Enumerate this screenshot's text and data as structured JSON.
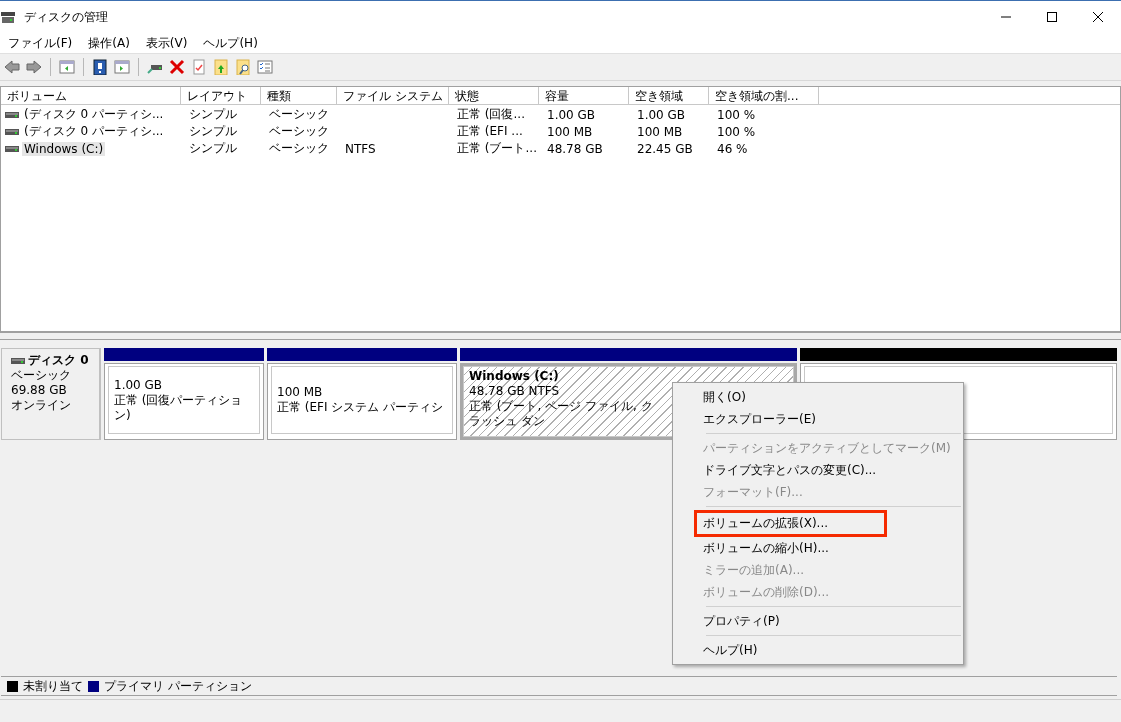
{
  "window": {
    "title": "ディスクの管理"
  },
  "menu_bar": [
    "ファイル(F)",
    "操作(A)",
    "表示(V)",
    "ヘルプ(H)"
  ],
  "volume_list": {
    "columns": [
      "ボリューム",
      "レイアウト",
      "種類",
      "ファイル システム",
      "状態",
      "容量",
      "空き領域",
      "空き領域の割..."
    ],
    "rows": [
      {
        "selected": false,
        "cells": [
          "(ディスク 0 パーティシ...",
          "シンプル",
          "ベーシック",
          "",
          "正常 (回復...",
          "1.00 GB",
          "1.00 GB",
          "100 %"
        ]
      },
      {
        "selected": false,
        "cells": [
          "(ディスク 0 パーティシ...",
          "シンプル",
          "ベーシック",
          "",
          "正常 (EFI ...",
          "100 MB",
          "100 MB",
          "100 %"
        ]
      },
      {
        "selected": true,
        "cells": [
          "Windows (C:)",
          "シンプル",
          "ベーシック",
          "NTFS",
          "正常 (ブート...",
          "48.78 GB",
          "22.45 GB",
          "46 %"
        ]
      }
    ]
  },
  "disks": [
    {
      "name": "ディスク 0",
      "type": "ベーシック",
      "size": "69.88 GB",
      "status": "オンライン",
      "partitions": [
        {
          "color": "#000080",
          "selected": false,
          "size": "1.00 GB",
          "status": "正常 (回復パーティション)"
        },
        {
          "color": "#000080",
          "selected": false,
          "size": "100 MB",
          "status": "正常 (EFI システム パーティシ"
        },
        {
          "color": "#000080",
          "selected": true,
          "title": "Windows (C:)",
          "size": "48.78 GB NTFS",
          "status": "正常 (ブート, ページ ファイル, クラッシュ ダン"
        },
        {
          "color": "#000000",
          "selected": false
        }
      ]
    }
  ],
  "context_menu": [
    {
      "kind": "item",
      "label": "開く(O)",
      "disabled": false,
      "highlighted": false
    },
    {
      "kind": "item",
      "label": "エクスプローラー(E)",
      "disabled": false,
      "highlighted": false
    },
    {
      "kind": "separator"
    },
    {
      "kind": "item",
      "label": "パーティションをアクティブとしてマーク(M)",
      "disabled": true,
      "highlighted": false
    },
    {
      "kind": "item",
      "label": "ドライブ文字とパスの変更(C)...",
      "disabled": false,
      "highlighted": false
    },
    {
      "kind": "item",
      "label": "フォーマット(F)...",
      "disabled": true,
      "highlighted": false
    },
    {
      "kind": "separator"
    },
    {
      "kind": "item",
      "label": "ボリュームの拡張(X)...",
      "disabled": false,
      "highlighted": true
    },
    {
      "kind": "item",
      "label": "ボリュームの縮小(H)...",
      "disabled": false,
      "highlighted": false
    },
    {
      "kind": "item",
      "label": "ミラーの追加(A)...",
      "disabled": true,
      "highlighted": false
    },
    {
      "kind": "item",
      "label": "ボリュームの削除(D)...",
      "disabled": true,
      "highlighted": false
    },
    {
      "kind": "separator"
    },
    {
      "kind": "item",
      "label": "プロパティ(P)",
      "disabled": false,
      "highlighted": false
    },
    {
      "kind": "separator"
    },
    {
      "kind": "item",
      "label": "ヘルプ(H)",
      "disabled": false,
      "highlighted": false
    }
  ],
  "legend": [
    {
      "label": "未割り当て",
      "color": "#000000"
    },
    {
      "label": "プライマリ パーティション",
      "color": "#000080"
    }
  ]
}
